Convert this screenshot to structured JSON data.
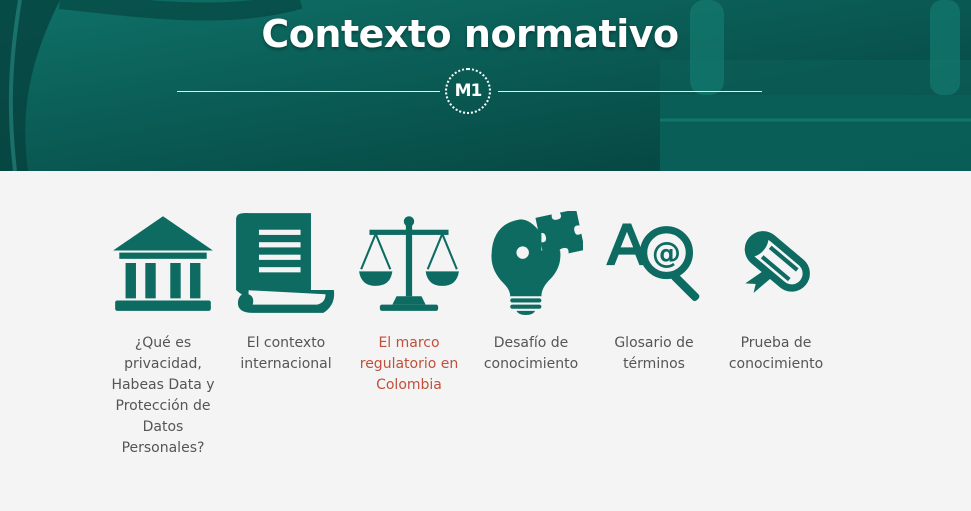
{
  "header": {
    "title": "Contexto normativo",
    "badge": "M1"
  },
  "colors": {
    "banner": "#0b5d56",
    "icon": "#0d6b62",
    "active_label": "#c0503a",
    "label": "#555555"
  },
  "items": [
    {
      "label": "¿Qué es privacidad, Habeas Data y Protección de Datos Personales?",
      "icon": "building-icon",
      "active": false
    },
    {
      "label": "El contexto internacional",
      "icon": "scroll-document-icon",
      "active": false
    },
    {
      "label": "El marco regulatorio en Colombia",
      "icon": "scales-icon",
      "active": true
    },
    {
      "label": "Desafío de conocimiento",
      "icon": "lightbulb-puzzle-icon",
      "active": false
    },
    {
      "label": "Glosario de términos",
      "icon": "glossary-search-icon",
      "active": false
    },
    {
      "label": "Prueba de conocimiento",
      "icon": "diploma-icon",
      "active": false
    }
  ]
}
